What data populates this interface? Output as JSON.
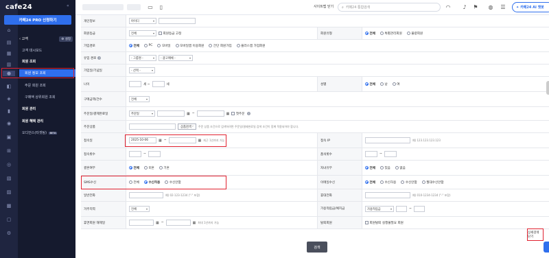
{
  "app": {
    "logo": "cafe24",
    "collapse": "«",
    "pro_button": "카페24 PRO 신청하기"
  },
  "topbar": {
    "sitemap": "사이트맵 닫기",
    "search_placeholder": "카페24 통합검색",
    "ai_button": "카페24 AI 챗봇",
    "icons": [
      "monitor-icon",
      "mobile-icon",
      "headset-icon",
      "bell-icon",
      "flag-icon",
      "user-icon",
      "menu-icon"
    ]
  },
  "sidebar": {
    "section_title": "고객",
    "settings_label": "설정",
    "items": [
      {
        "label": "고객 대시보드",
        "type": "item"
      },
      {
        "label": "회원 조회",
        "type": "group"
      },
      {
        "label": "회원 정보 조회",
        "type": "sub",
        "active": true
      },
      {
        "label": "주문 회원 조회",
        "type": "sub"
      },
      {
        "label": "구매액 상위회원 조회",
        "type": "sub"
      },
      {
        "label": "회원 관리",
        "type": "group"
      },
      {
        "label": "회원 혜택 관리",
        "type": "group"
      },
      {
        "label": "오디언스(타겟팅)",
        "type": "item",
        "badge": "BETA"
      }
    ]
  },
  "form": {
    "rows": {
      "member_info": {
        "label": "개인정보",
        "select": "아이디"
      },
      "grade": {
        "label": "회원등급",
        "select": "전체",
        "fixed_label": "회원등급 고정",
        "right_label": "회원유형",
        "options": [
          "전체",
          "특별관리회원",
          "불량회원"
        ]
      },
      "join_path": {
        "label": "가입경로",
        "options": [
          "전체",
          "PC",
          "모바일",
          "모바일앱 이용회원",
          "간단 회원가입",
          "플러스앱 가입회원"
        ]
      },
      "inflow": {
        "label": "유입 경로",
        "select1": "- 그룹명 -",
        "select2": "- 광고매체 -"
      },
      "join_date": {
        "label": "가입일/기념일",
        "select": "- 선택 -"
      },
      "age": {
        "label": "나이",
        "unit_from": "세 ~",
        "unit_to": "세",
        "right_label": "성별",
        "options": [
          "전체",
          "남",
          "여"
        ]
      },
      "purchase": {
        "label": "구매금액/건수",
        "select": "전체"
      },
      "order_date": {
        "label": "주문일/결제완료일",
        "select": "주문일",
        "check": "첫주문"
      },
      "product": {
        "label": "주문상품",
        "button": "상품검색",
        "hint": "주문 상품 조건으로 검색하려면 주문일/결제완료일 검색 조건이 함께 적용되어야 합니다."
      },
      "access_date": {
        "label": "접속일",
        "from": "2025-10-06",
        "tilde": "~",
        "hint": "최근 1년까지 가능",
        "right_label": "접속 IP",
        "ip_hint": "예) 123.123.123.123"
      },
      "access_count": {
        "label": "접속횟수",
        "tilde": "~",
        "right_label": "품석횟수"
      },
      "gender_pass": {
        "label": "결혼여부",
        "options": [
          "전체",
          "미혼",
          "기혼"
        ],
        "right_label": "자녀유무",
        "right_options": [
          "전체",
          "있음",
          "없음"
        ]
      },
      "sms": {
        "label": "SMS수신",
        "options": [
          "전체",
          "수신허용",
          "수신안함"
        ],
        "right_label": "이메일수신",
        "right_options": [
          "전체",
          "수신허용",
          "수신안함",
          "월대수신안함"
        ]
      },
      "phone": {
        "label": "일반전화",
        "hint": "예) 02-123-1234 (\"-\" 포함)",
        "right_label": "휴대전화",
        "right_hint": "예) 010-1234-1234 (\"-\" 포함)"
      },
      "address": {
        "label": "거주지역",
        "select": "전체",
        "right_label": "가용적립금/예치금",
        "right_select": "가용적립금"
      },
      "dormant": {
        "label": "휴면회원 해제일",
        "tilde": "~",
        "hint": "최대 1년까지 가능",
        "right_label": "탈퇴회원",
        "right_check": "회원탈퇴 실행불필요 회원"
      }
    },
    "search_button": "검색",
    "detail_link": "상세검색 닫기"
  }
}
